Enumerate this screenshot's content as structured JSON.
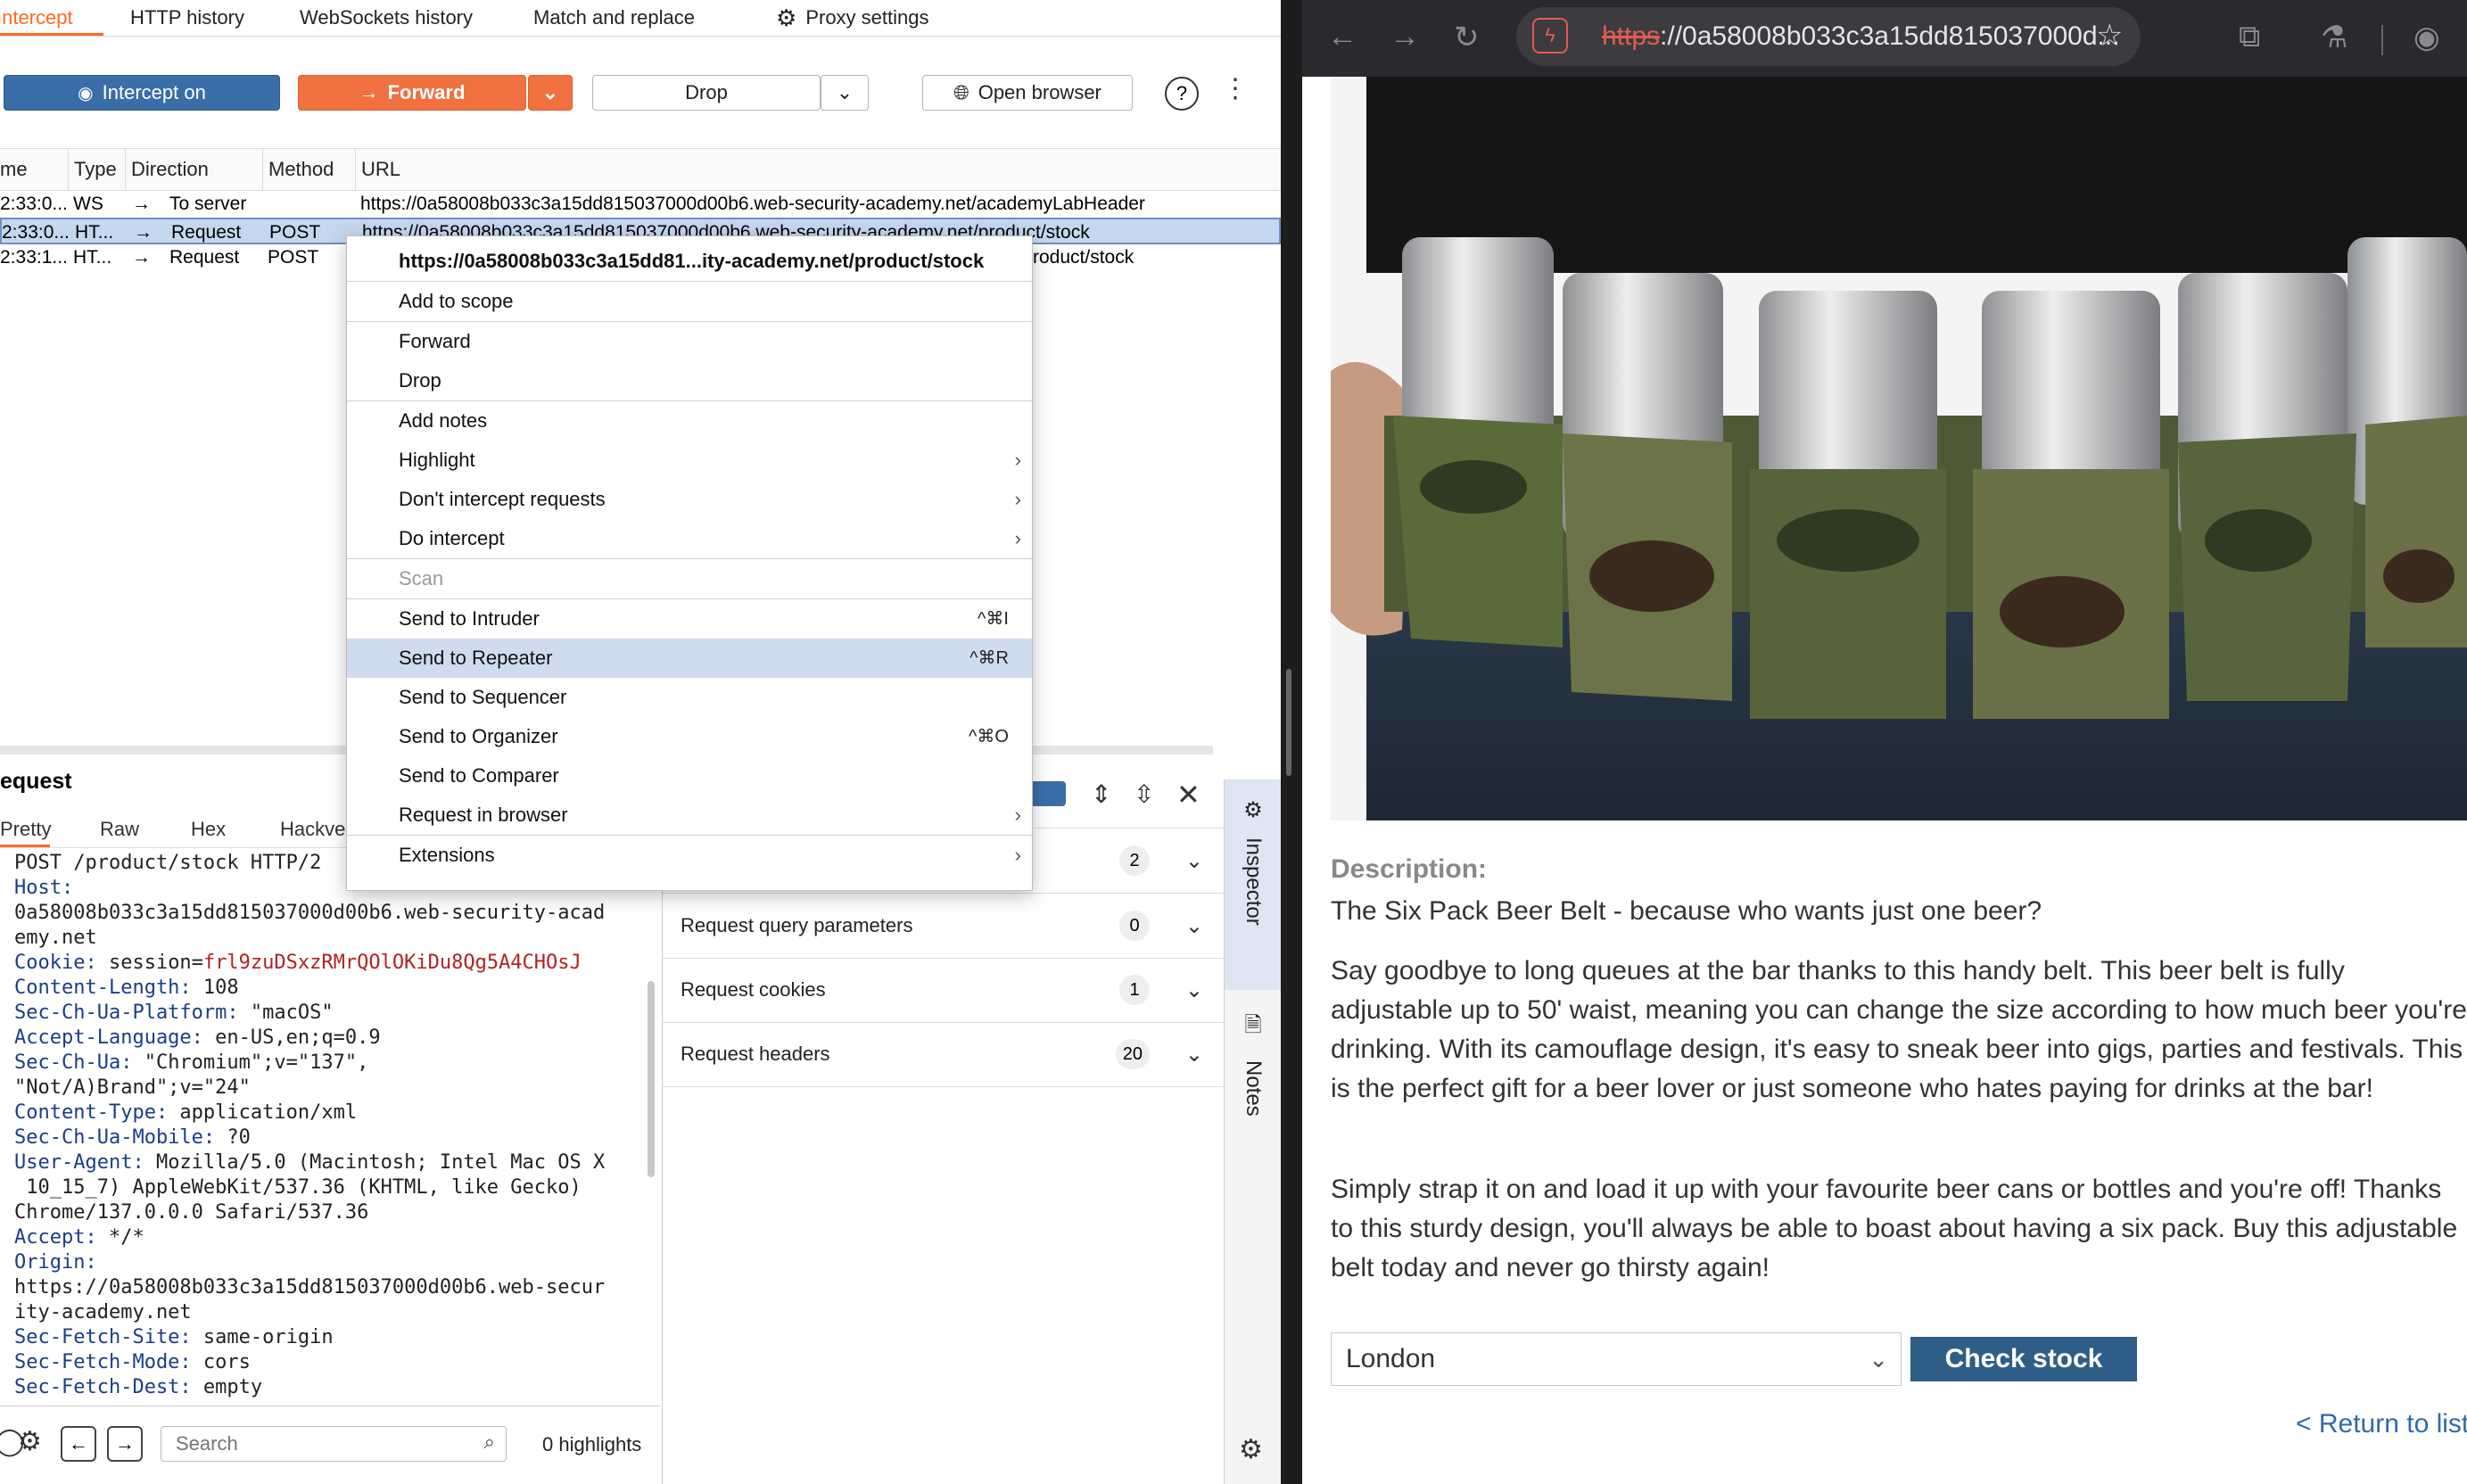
{
  "burp": {
    "tabs": [
      "Intercept",
      "HTTP history",
      "WebSockets history",
      "Match and replace",
      "Proxy settings"
    ],
    "toolbar": {
      "intercept": "Intercept on",
      "forward": "Forward",
      "drop": "Drop",
      "open_browser": "Open browser"
    },
    "table": {
      "headers": [
        "me",
        "Type",
        "Direction",
        "Method",
        "URL"
      ],
      "rows": [
        {
          "time": "2:33:0...",
          "type": "WS",
          "direction": "To server",
          "method": "",
          "url": "https://0a58008b033c3a15dd815037000d00b6.web-security-academy.net/academyLabHeader"
        },
        {
          "time": "2:33:0...",
          "type": "HT...",
          "direction": "Request",
          "method": "POST",
          "url": "https://0a58008b033c3a15dd815037000d00b6.web-security-academy.net/product/stock"
        },
        {
          "time": "2:33:1...",
          "type": "HT...",
          "direction": "Request",
          "method": "POST",
          "url": "roduct/stock"
        }
      ]
    },
    "request": {
      "title": "equest",
      "tabs": [
        "Pretty",
        "Raw",
        "Hex",
        "Hackve"
      ],
      "lines": [
        {
          "k": "",
          "v": "POST /product/stock HTTP/2"
        },
        {
          "k": "Host:",
          "v": ""
        },
        {
          "k": "",
          "v": "0a58008b033c3a15dd815037000d00b6.web-security-acad"
        },
        {
          "k": "",
          "v": "emy.net"
        },
        {
          "k": "Cookie:",
          "v": " session=",
          "red": "frl9zuDSxzRMrQOlOKiDu8Qg5A4CHOsJ"
        },
        {
          "k": "Content-Length:",
          "v": " 108"
        },
        {
          "k": "Sec-Ch-Ua-Platform:",
          "v": " \"macOS\""
        },
        {
          "k": "Accept-Language:",
          "v": " en-US,en;q=0.9"
        },
        {
          "k": "Sec-Ch-Ua:",
          "v": " \"Chromium\";v=\"137\","
        },
        {
          "k": "",
          "v": "\"Not/A)Brand\";v=\"24\""
        },
        {
          "k": "Content-Type:",
          "v": " application/xml"
        },
        {
          "k": "Sec-Ch-Ua-Mobile:",
          "v": " ?0"
        },
        {
          "k": "User-Agent:",
          "v": " Mozilla/5.0 (Macintosh; Intel Mac OS X"
        },
        {
          "k": "",
          "v": " 10_15_7) AppleWebKit/537.36 (KHTML, like Gecko)"
        },
        {
          "k": "",
          "v": "Chrome/137.0.0.0 Safari/537.36"
        },
        {
          "k": "Accept:",
          "v": " */*"
        },
        {
          "k": "Origin:",
          "v": ""
        },
        {
          "k": "",
          "v": "https://0a58008b033c3a15dd815037000d00b6.web-secur"
        },
        {
          "k": "",
          "v": "ity-academy.net"
        },
        {
          "k": "Sec-Fetch-Site:",
          "v": " same-origin"
        },
        {
          "k": "Sec-Fetch-Mode:",
          "v": " cors"
        },
        {
          "k": "Sec-Fetch-Dest:",
          "v": " empty"
        }
      ],
      "search_placeholder": "Search",
      "highlights": "0 highlights"
    },
    "inspector": {
      "rows": [
        {
          "label": "",
          "count": "2"
        },
        {
          "label": "Request query parameters",
          "count": "0"
        },
        {
          "label": "Request cookies",
          "count": "1"
        },
        {
          "label": "Request headers",
          "count": "20"
        }
      ],
      "rail": [
        "Inspector",
        "Notes"
      ]
    },
    "context_menu": {
      "url": "https://0a58008b033c3a15dd81...ity-academy.net/product/stock",
      "items": [
        {
          "label": "Add to scope",
          "sc": "",
          "sub": false,
          "dis": false
        },
        {
          "label": "Forward",
          "sc": "",
          "sub": false,
          "dis": false
        },
        {
          "label": "Drop",
          "sc": "",
          "sub": false,
          "dis": false
        },
        {
          "label": "Add notes",
          "sc": "",
          "sub": false,
          "dis": false
        },
        {
          "label": "Highlight",
          "sc": "",
          "sub": true,
          "dis": false
        },
        {
          "label": "Don't intercept requests",
          "sc": "",
          "sub": true,
          "dis": false
        },
        {
          "label": "Do intercept",
          "sc": "",
          "sub": true,
          "dis": false
        },
        {
          "label": "Scan",
          "sc": "",
          "sub": false,
          "dis": true
        },
        {
          "label": "Send to Intruder",
          "sc": "^⌘I",
          "sub": false,
          "dis": false
        },
        {
          "label": "Send to Repeater",
          "sc": "^⌘R",
          "sub": false,
          "dis": false,
          "hl": true
        },
        {
          "label": "Send to Sequencer",
          "sc": "",
          "sub": false,
          "dis": false
        },
        {
          "label": "Send to Organizer",
          "sc": "^⌘O",
          "sub": false,
          "dis": false
        },
        {
          "label": "Send to Comparer",
          "sc": "",
          "sub": false,
          "dis": false
        },
        {
          "label": "Request in browser",
          "sc": "",
          "sub": true,
          "dis": false
        },
        {
          "label": "Extensions",
          "sc": "",
          "sub": true,
          "dis": false
        }
      ]
    }
  },
  "browser": {
    "url_scheme": "https",
    "url_rest": "://0a58008b033c3a15dd815037000d...",
    "description_heading": "Description:",
    "tagline": "The Six Pack Beer Belt - because who wants just one beer?",
    "para1": "Say goodbye to long queues at the bar thanks to this handy belt. This beer belt is fully adjustable up to 50' waist, meaning you can change the size according to how much beer you're drinking. With its camouflage design, it's easy to sneak beer into gigs, parties and festivals. This is the perfect gift for a beer lover or just someone who hates paying for drinks at the bar!",
    "para2": "Simply strap it on and load it up with your favourite beer cans or bottles and you're off! Thanks to this sturdy design, you'll always be able to boast about having a six pack. Buy this adjustable belt today and never go thirsty again!",
    "store_select": "London",
    "check_stock": "Check stock",
    "return_link": "< Return to list"
  },
  "colors": {
    "burp_orange": "#ff6a22",
    "burp_blue": "#3a6ea8",
    "check_stock_bg": "#2e5e87",
    "link_blue": "#2e6ab0"
  }
}
